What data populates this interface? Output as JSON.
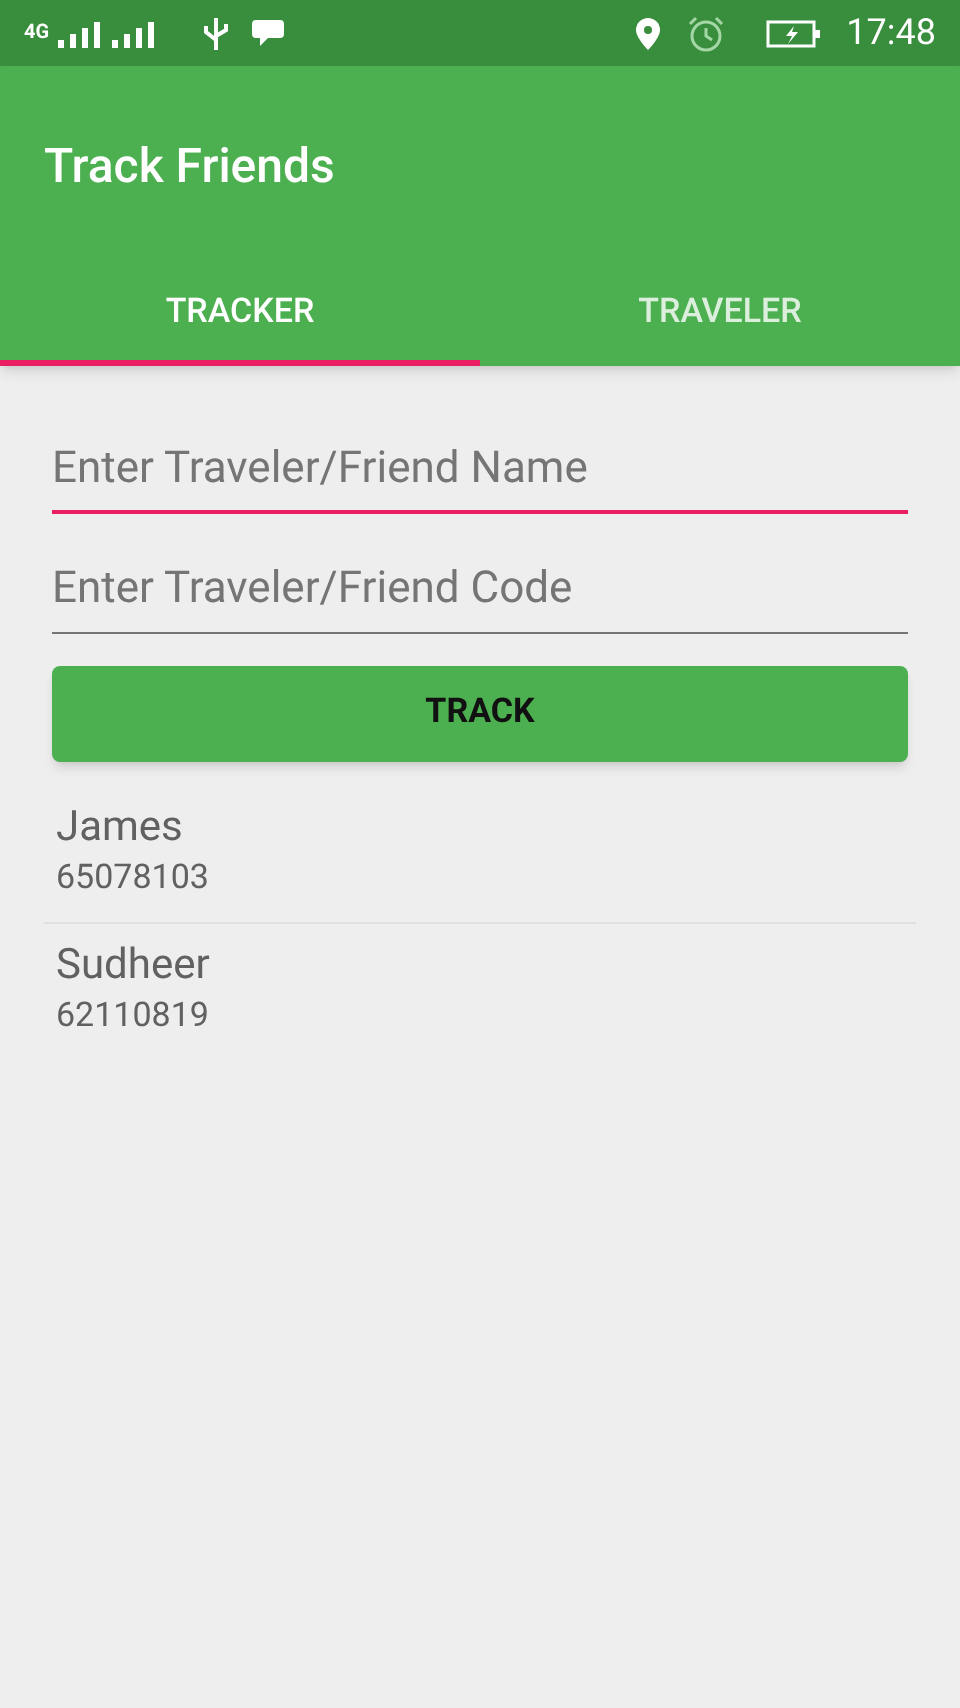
{
  "status_bar": {
    "network": "4G",
    "time": "17:48"
  },
  "app_bar": {
    "title": "Track Friends"
  },
  "tabs": [
    {
      "label": "TRACKER",
      "selected": true
    },
    {
      "label": "TRAVELER",
      "selected": false
    }
  ],
  "fields": [
    {
      "placeholder": "Enter Traveler/Friend Name",
      "focused": true
    },
    {
      "placeholder": "Enter Traveler/Friend Code",
      "focused": false
    }
  ],
  "button": {
    "label": "TRACK"
  },
  "friends": [
    {
      "name": "James",
      "code": "65078103"
    },
    {
      "name": "Sudheer",
      "code": "62110819"
    }
  ]
}
